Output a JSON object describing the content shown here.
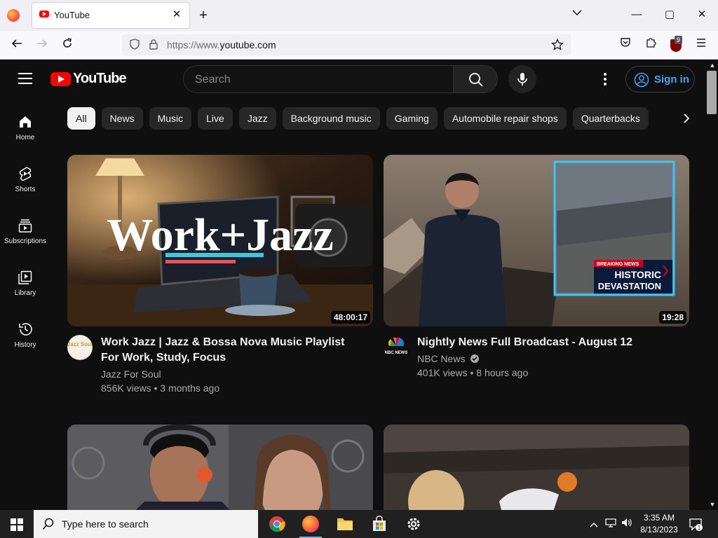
{
  "browser": {
    "tab_title": "YouTube",
    "tab_close": "✕",
    "new_tab": "+",
    "url_prefix": "https://www.",
    "url_domain": "youtube.com",
    "extension_badge": "9",
    "window_buttons": {
      "minimize": "—",
      "maximize": "▢",
      "close": "✕"
    }
  },
  "youtube": {
    "logo_text": "YouTube",
    "search_placeholder": "Search",
    "signin_label": "Sign in",
    "sidebar": [
      {
        "label": "Home",
        "icon": "home-icon"
      },
      {
        "label": "Shorts",
        "icon": "shorts-icon"
      },
      {
        "label": "Subscriptions",
        "icon": "subscriptions-icon"
      },
      {
        "label": "Library",
        "icon": "library-icon"
      },
      {
        "label": "History",
        "icon": "history-icon"
      }
    ],
    "chips": [
      "All",
      "News",
      "Music",
      "Live",
      "Jazz",
      "Background music",
      "Gaming",
      "Automobile repair shops",
      "Quarterbacks"
    ],
    "videos": [
      {
        "title": "Work Jazz | Jazz & Bossa Nova Music Playlist For Work, Study, Focus",
        "thumb_text": "Work+Jazz",
        "channel": "Jazz For Soul",
        "avatar_text": "Jazz Soul",
        "views": "856K views",
        "age": "3 months ago",
        "duration": "48:00:17"
      },
      {
        "title": "Nightly News Full Broadcast - August 12",
        "thumb_text_1": "BREAKING NEWS",
        "thumb_text_2": "HISTORIC",
        "thumb_text_3": "DEVASTATION",
        "channel": "NBC News",
        "avatar_text": "NBC NEWS",
        "views": "401K views",
        "age": "8 hours ago",
        "duration": "19:28"
      }
    ],
    "separator": "•",
    "colors": {
      "background": "#0f0f0f",
      "chip": "#272727",
      "accent_link": "#3ea6ff",
      "brand_red": "#ff0000"
    }
  },
  "taskbar": {
    "search_placeholder": "Type here to search",
    "time": "3:35 AM",
    "date": "8/13/2023",
    "notification_count": "1"
  }
}
